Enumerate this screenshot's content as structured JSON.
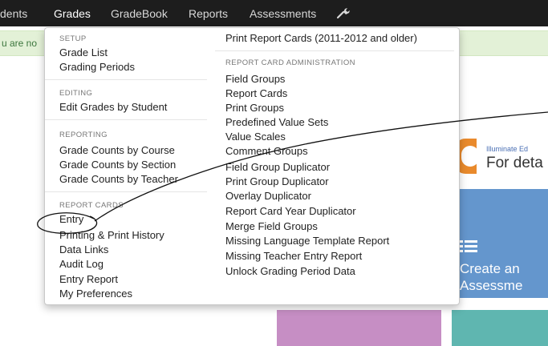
{
  "navbar": {
    "items": [
      "dents",
      "Grades",
      "GradeBook",
      "Reports",
      "Assessments"
    ],
    "active": "Grades",
    "settings_icon": "wrench-icon"
  },
  "alert": {
    "text": "u are no"
  },
  "background": {
    "illuminate_brand": "Illuminate Ed",
    "illuminate_text": "For deta",
    "create_tile_line1": "Create an",
    "create_tile_line2": "Assessme",
    "create_tile_icon": "list-icon"
  },
  "menu": {
    "left": {
      "setup": {
        "header": "SETUP",
        "items": [
          "Grade List",
          "Grading Periods"
        ]
      },
      "editing": {
        "header": "EDITING",
        "items": [
          "Edit Grades by Student"
        ]
      },
      "reporting": {
        "header": "REPORTING",
        "items": [
          "Grade Counts by Course",
          "Grade Counts by Section",
          "Grade Counts by Teacher"
        ]
      },
      "report_cards": {
        "header": "REPORT CARDS",
        "items": [
          "Entry",
          "Printing & Print History",
          "Data Links",
          "Audit Log",
          "Entry Report",
          "My Preferences"
        ]
      }
    },
    "right": {
      "top_item": "Print Report Cards (2011-2012 and older)",
      "admin": {
        "header": "REPORT CARD ADMINISTRATION",
        "items": [
          "Field Groups",
          "Report Cards",
          "Print Groups",
          "Predefined Value Sets",
          "Value Scales",
          "Comment Groups",
          "Field Group Duplicator",
          "Print Group Duplicator",
          "Overlay Duplicator",
          "Report Card Year Duplicator",
          "Merge Field Groups",
          "Missing Language Template Report",
          "Missing Teacher Entry Report",
          "Unlock Grading Period Data"
        ]
      }
    }
  },
  "colors": {
    "navbar": "#1d1d1d",
    "alert": "#e3f1d7",
    "tile_blue": "#6496cd",
    "tile_purple": "#c68ec4",
    "tile_teal": "#5fb6b0",
    "illuminate_orange": "#e98a2c"
  }
}
